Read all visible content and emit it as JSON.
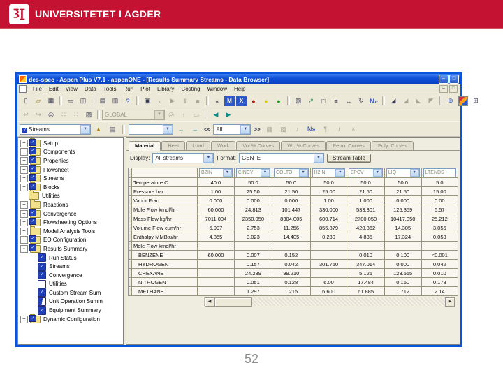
{
  "banner": {
    "university": "UNIVERSITETET I AGDER"
  },
  "slide": {
    "page_number": "52"
  },
  "window": {
    "title": "des-spec - Aspen Plus V7.1 - aspenONE - [Results Summary Streams - Data Browser]",
    "menu": [
      "File",
      "Edit",
      "View",
      "Data",
      "Tools",
      "Run",
      "Plot",
      "Library",
      "Costing",
      "Window",
      "Help"
    ],
    "toolbar_main": [
      {
        "icon": "new-icon"
      },
      {
        "icon": "open-icon"
      },
      {
        "icon": "save-icon"
      },
      {
        "sep": true
      },
      {
        "icon": "print-icon"
      },
      {
        "icon": "print-preview-icon"
      },
      {
        "sep": true
      },
      {
        "icon": "copy-icon"
      },
      {
        "icon": "paste-icon"
      },
      {
        "icon": "whats-this-icon"
      },
      {
        "sep": true
      },
      {
        "icon": "control-panel-icon"
      },
      {
        "icon": "step-icon",
        "disabled": true
      },
      {
        "icon": "run-icon",
        "disabled": true
      },
      {
        "icon": "pause-icon",
        "disabled": true
      },
      {
        "icon": "stop-icon",
        "disabled": true
      },
      {
        "sep": true
      },
      {
        "icon": "reinitialize-icon"
      },
      {
        "icon": "data-fit-icon"
      },
      {
        "icon": "excel-x-icon"
      },
      {
        "icon": "status-red-icon"
      },
      {
        "icon": "status-yellow-icon"
      },
      {
        "icon": "status-green-icon"
      },
      {
        "sep": true
      },
      {
        "icon": "flowsheet-icon"
      },
      {
        "icon": "insert-stream-icon"
      },
      {
        "icon": "insert-block-icon"
      },
      {
        "icon": "section-icon"
      },
      {
        "icon": "align-icon"
      },
      {
        "icon": "rotate-icon"
      },
      {
        "icon": "next-input-icon"
      },
      {
        "sep": true
      },
      {
        "icon": "plot-xy-icon"
      },
      {
        "icon": "plot-parametric-icon",
        "disabled": true
      },
      {
        "icon": "plot-add-icon",
        "disabled": true
      },
      {
        "icon": "plot-residue-icon",
        "disabled": true
      },
      {
        "sep": true
      },
      {
        "icon": "web-icon"
      },
      {
        "icon": "aspen-icon"
      },
      {
        "icon": "datasheet-icon"
      }
    ],
    "toolbar_secondary": [
      {
        "icon": "undo-icon",
        "disabled": true
      },
      {
        "icon": "redo-icon",
        "disabled": true
      },
      {
        "icon": "capture-icon"
      },
      {
        "icon": "list-insert-icon",
        "disabled": true
      },
      {
        "icon": "list-remove-icon",
        "disabled": true
      },
      {
        "icon": "export-image-icon"
      },
      {
        "sep": true
      },
      {
        "combo": "GLOBAL",
        "disabled": true,
        "name": "section-combo"
      },
      {
        "icon": "find-icon",
        "disabled": true
      },
      {
        "icon": "sort-icon",
        "disabled": true
      },
      {
        "icon": "print-section-icon",
        "disabled": true
      },
      {
        "sep": true
      },
      {
        "icon": "move-left-icon"
      },
      {
        "icon": "move-right-icon"
      }
    ],
    "browser_bar": {
      "object_combo": "Streams",
      "icons_left": [
        {
          "icon": "parent-node-icon"
        },
        {
          "icon": "sheet-icon"
        }
      ],
      "units_combo": "",
      "prev_label": "<<",
      "range_combo": "All",
      "next_label": ">>",
      "nav_icons": [
        {
          "icon": "back-arrow-icon"
        },
        {
          "icon": "forward-arrow-icon"
        }
      ],
      "icons_right": [
        {
          "icon": "save-case-icon",
          "disabled": true
        },
        {
          "icon": "restore-case-icon",
          "disabled": true
        },
        {
          "icon": "sound-icon",
          "disabled": true
        },
        {
          "icon": "next-input-icon"
        },
        {
          "icon": "comment-icon",
          "disabled": true
        },
        {
          "icon": "modify-icon",
          "disabled": true
        },
        {
          "icon": "delete-icon",
          "disabled": true
        }
      ]
    },
    "tree": {
      "items": [
        {
          "label": "Setup",
          "icon": "folder-check",
          "level": 0,
          "expand": "+"
        },
        {
          "label": "Components",
          "icon": "folder-check",
          "level": 0,
          "expand": "+"
        },
        {
          "label": "Properties",
          "icon": "folder-check",
          "level": 0,
          "expand": "+"
        },
        {
          "label": "Flowsheet",
          "icon": "folder-check",
          "level": 0,
          "expand": "+"
        },
        {
          "label": "Streams",
          "icon": "folder-check",
          "level": 0,
          "expand": "+"
        },
        {
          "label": "Blocks",
          "icon": "folder-check",
          "level": 0,
          "expand": "+"
        },
        {
          "label": "Utilities",
          "icon": "folder",
          "level": 0,
          "expand": ""
        },
        {
          "label": "Reactions",
          "icon": "folder",
          "level": 0,
          "expand": "+"
        },
        {
          "label": "Convergence",
          "icon": "folder-check",
          "level": 0,
          "expand": "+"
        },
        {
          "label": "Flowsheeting Options",
          "icon": "folder-check",
          "level": 0,
          "expand": "+"
        },
        {
          "label": "Model Analysis Tools",
          "icon": "folder",
          "level": 0,
          "expand": "+"
        },
        {
          "label": "EO Configuration",
          "icon": "folder-check",
          "level": 0,
          "expand": "+"
        },
        {
          "label": "Results Summary",
          "icon": "folder-check",
          "level": 0,
          "expand": "-"
        },
        {
          "label": "Run Status",
          "icon": "form-check",
          "level": 1,
          "expand": ""
        },
        {
          "label": "Streams",
          "icon": "form-check",
          "level": 1,
          "expand": ""
        },
        {
          "label": "Convergence",
          "icon": "form-check",
          "level": 1,
          "expand": ""
        },
        {
          "label": "Utilities",
          "icon": "form-empty",
          "level": 1,
          "expand": ""
        },
        {
          "label": "Custom Stream Sum",
          "icon": "form-check",
          "level": 1,
          "expand": ""
        },
        {
          "label": "Unit Operation Summ",
          "icon": "form-half",
          "level": 1,
          "expand": ""
        },
        {
          "label": "Equipment Summary",
          "icon": "form-check",
          "level": 1,
          "expand": ""
        },
        {
          "label": "Dynamic Configuration",
          "icon": "folder-check",
          "level": 0,
          "expand": "+"
        }
      ]
    },
    "tabs": [
      {
        "label": "Material",
        "active": true
      },
      {
        "label": "Heat",
        "active": false
      },
      {
        "label": "Load",
        "active": false
      },
      {
        "label": "Work",
        "active": false
      },
      {
        "label": "Vol.% Curves",
        "active": false
      },
      {
        "label": "Wt. % Curves",
        "active": false
      },
      {
        "label": "Petro. Curves",
        "active": false
      },
      {
        "label": "Poly. Curves",
        "active": false
      }
    ],
    "display_row": {
      "display_label": "Display:",
      "display_value": "All streams",
      "format_label": "Format:",
      "format_value": "GEN_E",
      "stream_table_button": "Stream Table"
    },
    "table": {
      "columns": [
        "BZIN",
        "CINCY",
        "COLTO",
        "H2IN",
        "3PCV",
        "LIQ",
        "LTENDS"
      ],
      "rows": [
        {
          "label": "Temperature C",
          "indent": false,
          "values": [
            "40.0",
            "50.0",
            "50.0",
            "50.0",
            "50.0",
            "50.0",
            "5.0"
          ]
        },
        {
          "label": "Pressure bar",
          "indent": false,
          "values": [
            "1.00",
            "25.50",
            "21.50",
            "25.00",
            "21.50",
            "21.50",
            "15.00"
          ]
        },
        {
          "label": "Vapor Frac",
          "indent": false,
          "values": [
            "0.000",
            "0.000",
            "0.000",
            "1.00",
            "1.000",
            "0.000",
            "0.00"
          ]
        },
        {
          "label": "Mole Flow kmol/hr",
          "indent": false,
          "values": [
            "60.000",
            "24.813",
            "101.447",
            "330.000",
            "533.301",
            "125.359",
            "5.57"
          ]
        },
        {
          "label": "Mass Flow kg/hr",
          "indent": false,
          "values": [
            "7011.004",
            "2350.050",
            "8304.005",
            "600.714",
            "2700.050",
            "10417.050",
            "25.212"
          ]
        },
        {
          "label": "Volume Flow cum/hr",
          "indent": false,
          "values": [
            "5.097",
            "2.753",
            "11.256",
            "855.879",
            "420.862",
            "14.305",
            "3.055"
          ]
        },
        {
          "label": "Enthalpy MMBtu/hr",
          "indent": false,
          "values": [
            "4.855",
            "3.023",
            "14.405",
            "0.230",
            "4.835",
            "17.324",
            "0.053"
          ]
        },
        {
          "label": "Mole Flow kmol/hr",
          "indent": false,
          "values": [
            "",
            "",
            "",
            "",
            "",
            "",
            ""
          ]
        },
        {
          "label": "BENZENE",
          "indent": true,
          "values": [
            "60.000",
            "0.007",
            "0.152",
            "",
            "0.010",
            "0.100",
            "<0.001"
          ]
        },
        {
          "label": "HYDROGEN",
          "indent": true,
          "values": [
            "",
            "0.157",
            "0.042",
            "301.750",
            "347.014",
            "0.000",
            "0.042"
          ]
        },
        {
          "label": "CHEXANE",
          "indent": true,
          "values": [
            "",
            "24.289",
            "99.210",
            "",
            "5.125",
            "123.555",
            "0.010"
          ]
        },
        {
          "label": "NITROGEN",
          "indent": true,
          "values": [
            "",
            "0.051",
            "0.128",
            "6.00",
            "17.484",
            "0.160",
            "0.173"
          ]
        },
        {
          "label": "METHANE",
          "indent": true,
          "values": [
            "",
            "1.297",
            "1.215",
            "6.600",
            "61.885",
            "1.712",
            "2.14"
          ]
        }
      ]
    }
  }
}
